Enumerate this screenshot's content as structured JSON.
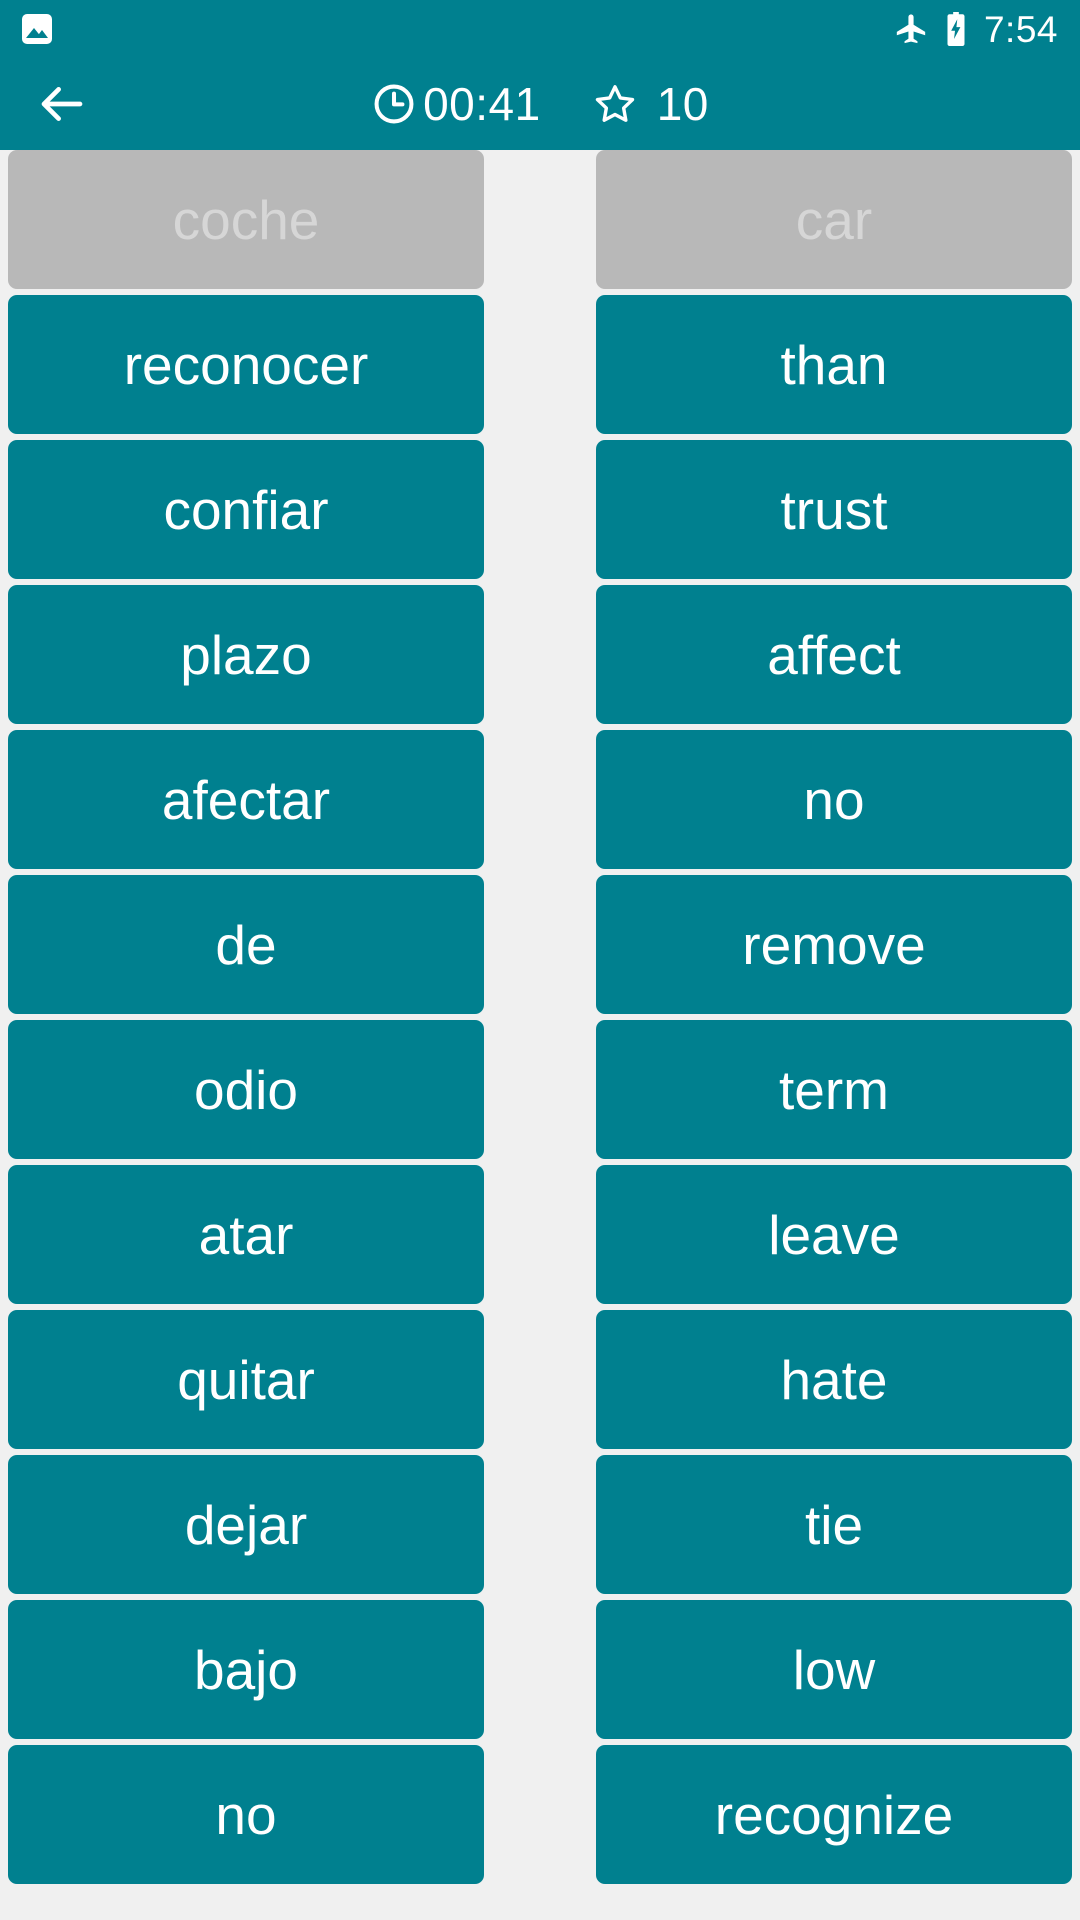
{
  "status_bar": {
    "notification_icon": "photo-icon",
    "airplane_mode_icon": "airplane-mode-icon",
    "battery_icon": "battery-charging-icon",
    "time": "7:54",
    "background_color": "#00808F"
  },
  "app_bar": {
    "back_icon": "back-arrow-icon",
    "timer_icon": "clock-icon",
    "timer": "00:41",
    "score_icon": "star-outline-icon",
    "score": "10",
    "background_color": "#00808F"
  },
  "board": {
    "card_color": "#00808F",
    "matched_card_color": "#B8B8B8",
    "matched_text_color": "#D6D6D6",
    "background_color": "#F0F0F0",
    "left_column": [
      {
        "label": "coche",
        "state": "matched"
      },
      {
        "label": "reconocer",
        "state": "active"
      },
      {
        "label": "confiar",
        "state": "active"
      },
      {
        "label": "plazo",
        "state": "active"
      },
      {
        "label": "afectar",
        "state": "active"
      },
      {
        "label": "de",
        "state": "active"
      },
      {
        "label": "odio",
        "state": "active"
      },
      {
        "label": "atar",
        "state": "active"
      },
      {
        "label": "quitar",
        "state": "active"
      },
      {
        "label": "dejar",
        "state": "active"
      },
      {
        "label": "bajo",
        "state": "active"
      },
      {
        "label": "no",
        "state": "active"
      }
    ],
    "right_column": [
      {
        "label": "car",
        "state": "matched"
      },
      {
        "label": "than",
        "state": "active"
      },
      {
        "label": "trust",
        "state": "active"
      },
      {
        "label": "affect",
        "state": "active"
      },
      {
        "label": "no",
        "state": "active"
      },
      {
        "label": "remove",
        "state": "active"
      },
      {
        "label": "term",
        "state": "active"
      },
      {
        "label": "leave",
        "state": "active"
      },
      {
        "label": "hate",
        "state": "active"
      },
      {
        "label": "tie",
        "state": "active"
      },
      {
        "label": "low",
        "state": "active"
      },
      {
        "label": "recognize",
        "state": "active"
      }
    ]
  }
}
